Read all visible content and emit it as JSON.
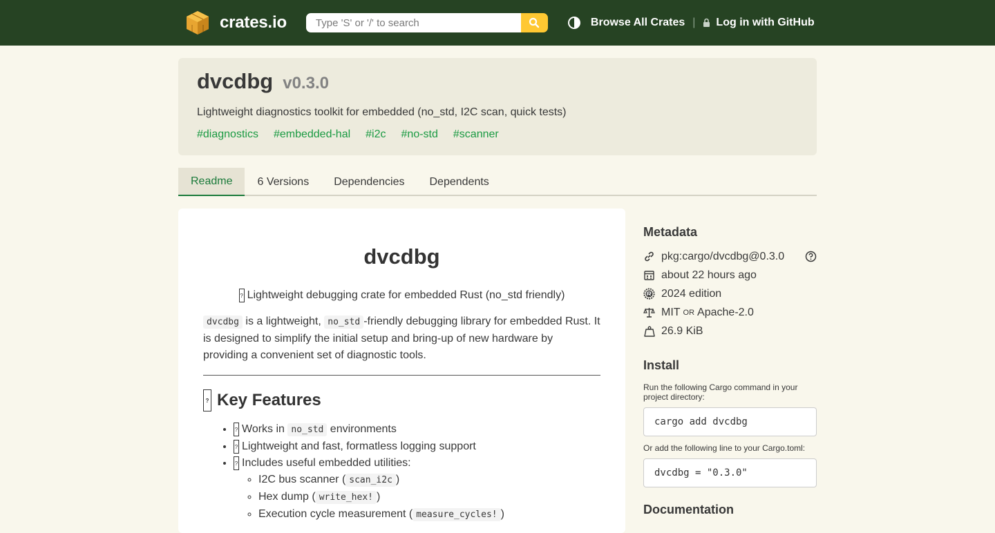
{
  "header": {
    "logo_text": "crates.io",
    "search_placeholder": "Type 'S' or '/' to search",
    "browse_label": "Browse All Crates",
    "separator": "|",
    "login_label": "Log in with GitHub",
    "colors": {
      "topbar": "#264323",
      "search_button": "#ffc832"
    }
  },
  "crate": {
    "name": "dvcdbg",
    "version": "v0.3.0",
    "description": "Lightweight diagnostics toolkit for embedded (no_std, I2C scan, quick tests)",
    "keywords": [
      "#diagnostics",
      "#embedded-hal",
      "#i2c",
      "#no-std",
      "#scanner"
    ]
  },
  "tabs": [
    "Readme",
    "6 Versions",
    "Dependencies",
    "Dependents"
  ],
  "readme": {
    "title": "dvcdbg",
    "tagline": "Lightweight debugging crate for embedded Rust (no_std friendly)",
    "intro_code1": "dvcdbg",
    "intro_t1": " is a lightweight, ",
    "intro_code2": "no_std",
    "intro_t2": "-friendly debugging library for embedded Rust. It is designed to simplify the initial setup and bring-up of new hardware by providing a convenient set of diagnostic tools.",
    "features_heading": "Key Features",
    "f1_pre": "Works in ",
    "f1_code": "no_std",
    "f1_post": " environments",
    "f2": "Lightweight and fast, formatless logging support",
    "f3": "Includes useful embedded utilities:",
    "s1_pre": "I2C bus scanner (",
    "s1_code": "scan_i2c",
    "s1_post": ")",
    "s2_pre": "Hex dump (",
    "s2_code": "write_hex!",
    "s2_post": ")",
    "s3_pre": "Execution cycle measurement (",
    "s3_code": "measure_cycles!",
    "s3_post": ")",
    "glyph": "?"
  },
  "sidebar": {
    "metadata_heading": "Metadata",
    "purl": "pkg:cargo/dvcdbg@0.3.0",
    "updated": "about 22 hours ago",
    "edition": "2024 edition",
    "license_a": "MIT",
    "license_or": "OR",
    "license_b": "Apache-2.0",
    "size": "26.9 KiB",
    "install_heading": "Install",
    "install_note": "Run the following Cargo command in your project directory:",
    "install_cmd": "cargo add dvcdbg",
    "toml_note": "Or add the following line to your Cargo.toml:",
    "toml_line": "dvcdbg = \"0.3.0\"",
    "documentation_heading": "Documentation"
  }
}
